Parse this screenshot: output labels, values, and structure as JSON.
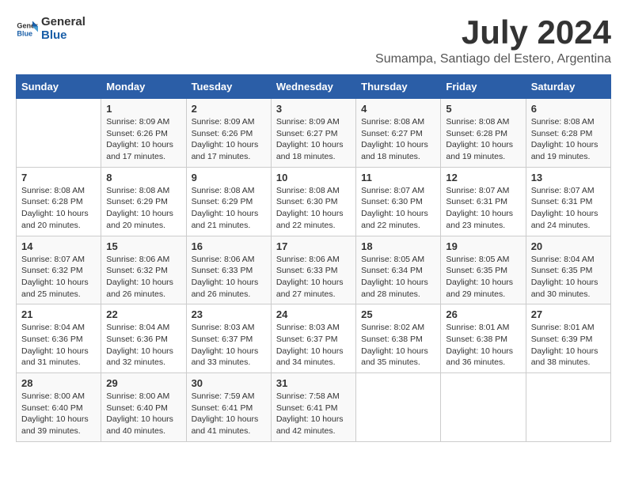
{
  "header": {
    "logo_general": "General",
    "logo_blue": "Blue",
    "title": "July 2024",
    "subtitle": "Sumampa, Santiago del Estero, Argentina"
  },
  "calendar": {
    "days_of_week": [
      "Sunday",
      "Monday",
      "Tuesday",
      "Wednesday",
      "Thursday",
      "Friday",
      "Saturday"
    ],
    "weeks": [
      [
        {
          "day": "",
          "sunrise": "",
          "sunset": "",
          "daylight": ""
        },
        {
          "day": "1",
          "sunrise": "Sunrise: 8:09 AM",
          "sunset": "Sunset: 6:26 PM",
          "daylight": "Daylight: 10 hours and 17 minutes."
        },
        {
          "day": "2",
          "sunrise": "Sunrise: 8:09 AM",
          "sunset": "Sunset: 6:26 PM",
          "daylight": "Daylight: 10 hours and 17 minutes."
        },
        {
          "day": "3",
          "sunrise": "Sunrise: 8:09 AM",
          "sunset": "Sunset: 6:27 PM",
          "daylight": "Daylight: 10 hours and 18 minutes."
        },
        {
          "day": "4",
          "sunrise": "Sunrise: 8:08 AM",
          "sunset": "Sunset: 6:27 PM",
          "daylight": "Daylight: 10 hours and 18 minutes."
        },
        {
          "day": "5",
          "sunrise": "Sunrise: 8:08 AM",
          "sunset": "Sunset: 6:28 PM",
          "daylight": "Daylight: 10 hours and 19 minutes."
        },
        {
          "day": "6",
          "sunrise": "Sunrise: 8:08 AM",
          "sunset": "Sunset: 6:28 PM",
          "daylight": "Daylight: 10 hours and 19 minutes."
        }
      ],
      [
        {
          "day": "7",
          "sunrise": "Sunrise: 8:08 AM",
          "sunset": "Sunset: 6:28 PM",
          "daylight": "Daylight: 10 hours and 20 minutes."
        },
        {
          "day": "8",
          "sunrise": "Sunrise: 8:08 AM",
          "sunset": "Sunset: 6:29 PM",
          "daylight": "Daylight: 10 hours and 20 minutes."
        },
        {
          "day": "9",
          "sunrise": "Sunrise: 8:08 AM",
          "sunset": "Sunset: 6:29 PM",
          "daylight": "Daylight: 10 hours and 21 minutes."
        },
        {
          "day": "10",
          "sunrise": "Sunrise: 8:08 AM",
          "sunset": "Sunset: 6:30 PM",
          "daylight": "Daylight: 10 hours and 22 minutes."
        },
        {
          "day": "11",
          "sunrise": "Sunrise: 8:07 AM",
          "sunset": "Sunset: 6:30 PM",
          "daylight": "Daylight: 10 hours and 22 minutes."
        },
        {
          "day": "12",
          "sunrise": "Sunrise: 8:07 AM",
          "sunset": "Sunset: 6:31 PM",
          "daylight": "Daylight: 10 hours and 23 minutes."
        },
        {
          "day": "13",
          "sunrise": "Sunrise: 8:07 AM",
          "sunset": "Sunset: 6:31 PM",
          "daylight": "Daylight: 10 hours and 24 minutes."
        }
      ],
      [
        {
          "day": "14",
          "sunrise": "Sunrise: 8:07 AM",
          "sunset": "Sunset: 6:32 PM",
          "daylight": "Daylight: 10 hours and 25 minutes."
        },
        {
          "day": "15",
          "sunrise": "Sunrise: 8:06 AM",
          "sunset": "Sunset: 6:32 PM",
          "daylight": "Daylight: 10 hours and 26 minutes."
        },
        {
          "day": "16",
          "sunrise": "Sunrise: 8:06 AM",
          "sunset": "Sunset: 6:33 PM",
          "daylight": "Daylight: 10 hours and 26 minutes."
        },
        {
          "day": "17",
          "sunrise": "Sunrise: 8:06 AM",
          "sunset": "Sunset: 6:33 PM",
          "daylight": "Daylight: 10 hours and 27 minutes."
        },
        {
          "day": "18",
          "sunrise": "Sunrise: 8:05 AM",
          "sunset": "Sunset: 6:34 PM",
          "daylight": "Daylight: 10 hours and 28 minutes."
        },
        {
          "day": "19",
          "sunrise": "Sunrise: 8:05 AM",
          "sunset": "Sunset: 6:35 PM",
          "daylight": "Daylight: 10 hours and 29 minutes."
        },
        {
          "day": "20",
          "sunrise": "Sunrise: 8:04 AM",
          "sunset": "Sunset: 6:35 PM",
          "daylight": "Daylight: 10 hours and 30 minutes."
        }
      ],
      [
        {
          "day": "21",
          "sunrise": "Sunrise: 8:04 AM",
          "sunset": "Sunset: 6:36 PM",
          "daylight": "Daylight: 10 hours and 31 minutes."
        },
        {
          "day": "22",
          "sunrise": "Sunrise: 8:04 AM",
          "sunset": "Sunset: 6:36 PM",
          "daylight": "Daylight: 10 hours and 32 minutes."
        },
        {
          "day": "23",
          "sunrise": "Sunrise: 8:03 AM",
          "sunset": "Sunset: 6:37 PM",
          "daylight": "Daylight: 10 hours and 33 minutes."
        },
        {
          "day": "24",
          "sunrise": "Sunrise: 8:03 AM",
          "sunset": "Sunset: 6:37 PM",
          "daylight": "Daylight: 10 hours and 34 minutes."
        },
        {
          "day": "25",
          "sunrise": "Sunrise: 8:02 AM",
          "sunset": "Sunset: 6:38 PM",
          "daylight": "Daylight: 10 hours and 35 minutes."
        },
        {
          "day": "26",
          "sunrise": "Sunrise: 8:01 AM",
          "sunset": "Sunset: 6:38 PM",
          "daylight": "Daylight: 10 hours and 36 minutes."
        },
        {
          "day": "27",
          "sunrise": "Sunrise: 8:01 AM",
          "sunset": "Sunset: 6:39 PM",
          "daylight": "Daylight: 10 hours and 38 minutes."
        }
      ],
      [
        {
          "day": "28",
          "sunrise": "Sunrise: 8:00 AM",
          "sunset": "Sunset: 6:40 PM",
          "daylight": "Daylight: 10 hours and 39 minutes."
        },
        {
          "day": "29",
          "sunrise": "Sunrise: 8:00 AM",
          "sunset": "Sunset: 6:40 PM",
          "daylight": "Daylight: 10 hours and 40 minutes."
        },
        {
          "day": "30",
          "sunrise": "Sunrise: 7:59 AM",
          "sunset": "Sunset: 6:41 PM",
          "daylight": "Daylight: 10 hours and 41 minutes."
        },
        {
          "day": "31",
          "sunrise": "Sunrise: 7:58 AM",
          "sunset": "Sunset: 6:41 PM",
          "daylight": "Daylight: 10 hours and 42 minutes."
        },
        {
          "day": "",
          "sunrise": "",
          "sunset": "",
          "daylight": ""
        },
        {
          "day": "",
          "sunrise": "",
          "sunset": "",
          "daylight": ""
        },
        {
          "day": "",
          "sunrise": "",
          "sunset": "",
          "daylight": ""
        }
      ]
    ]
  }
}
